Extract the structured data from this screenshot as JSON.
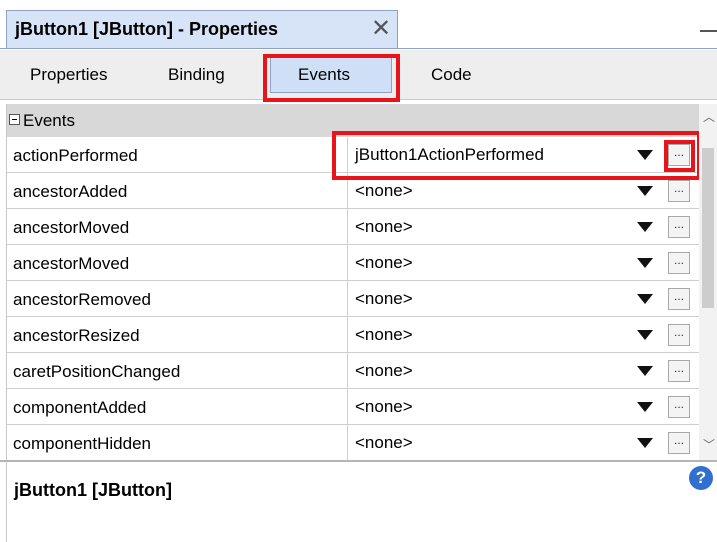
{
  "window": {
    "tab_title": "jButton1 [JButton] - Properties",
    "close_glyph": "✕"
  },
  "subtabs": [
    {
      "label": "Properties"
    },
    {
      "label": "Binding"
    },
    {
      "label": "Events",
      "selected": true
    },
    {
      "label": "Code"
    }
  ],
  "sheet": {
    "category": "Events",
    "rows": [
      {
        "name": "actionPerformed",
        "value": "jButton1ActionPerformed"
      },
      {
        "name": "ancestorAdded",
        "value": "<none>"
      },
      {
        "name": "ancestorMoved",
        "value": "<none>"
      },
      {
        "name": "ancestorMoved",
        "value": "<none>"
      },
      {
        "name": "ancestorRemoved",
        "value": "<none>"
      },
      {
        "name": "ancestorResized",
        "value": "<none>"
      },
      {
        "name": "caretPositionChanged",
        "value": "<none>"
      },
      {
        "name": "componentAdded",
        "value": "<none>"
      },
      {
        "name": "componentHidden",
        "value": "<none>"
      }
    ],
    "ellipsis_label": "..."
  },
  "footer": {
    "title": "jButton1 [JButton]",
    "help_glyph": "?"
  },
  "colors": {
    "highlight": "#e8141c",
    "selected_tab": "#cfe0f6",
    "category_bg": "#d8d8d8",
    "help_icon": "#2f6fd0"
  },
  "icons": {
    "close": "close-icon",
    "dropdown": "chevron-down-icon",
    "help": "help-icon",
    "collapse": "minus-box-icon"
  }
}
